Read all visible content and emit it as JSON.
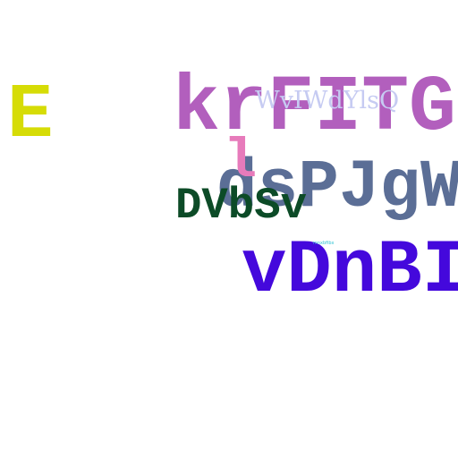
{
  "words": {
    "yellow_letter": {
      "text": "E",
      "color": "#d6dc06"
    },
    "purple_heading": {
      "text": "krFITGF",
      "color": "#b25fbd"
    },
    "faint_overlay": {
      "text": "WvIWdYlsQ",
      "color": "#c6cbf2"
    },
    "slate_word": {
      "text": "dsPJgWt",
      "color": "#5b6e96"
    },
    "pink_glyph": {
      "text": "l",
      "color": "#e77bbb"
    },
    "green_word": {
      "text": "DVbSv",
      "color": "#0c4b27"
    },
    "tiny_caption": {
      "text": "mnxbfibx",
      "color": "#33c3d4"
    },
    "violet_word": {
      "text": "vDnBI",
      "color": "#4408dc"
    }
  }
}
